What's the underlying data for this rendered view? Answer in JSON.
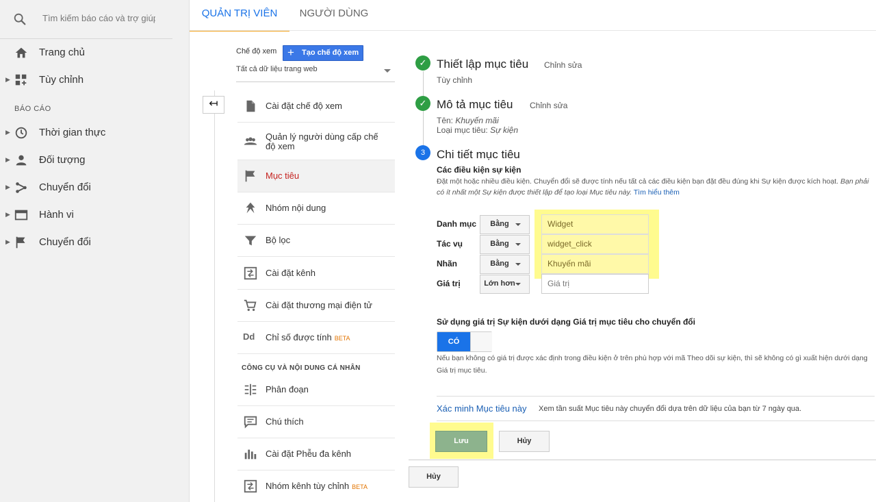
{
  "search": {
    "placeholder": "Tìm kiếm báo cáo và trợ giúp"
  },
  "sidebar": {
    "home": "Trang chủ",
    "customize": "Tùy chỉnh",
    "reports_heading": "BÁO CÁO",
    "reports": [
      "Thời gian thực",
      "Đối tượng",
      "Chuyển đổi",
      "Hành vi",
      "Chuyển đổi"
    ]
  },
  "tabs": {
    "admin": "QUẢN TRỊ VIÊN",
    "user": "NGƯỜI DÙNG"
  },
  "view": {
    "label": "Chế độ xem",
    "create_button": "Tạo chế độ xem",
    "selected": "Tất cả dữ liệu trang web"
  },
  "menu": {
    "items": [
      {
        "label": "Cài đặt chế độ xem",
        "icon": "document-icon"
      },
      {
        "label": "Quản lý người dùng cấp chế độ xem",
        "icon": "users-icon"
      },
      {
        "label": "Mục tiêu",
        "icon": "flag-icon"
      },
      {
        "label": "Nhóm nội dung",
        "icon": "content-grouping-icon"
      },
      {
        "label": "Bộ lọc",
        "icon": "filter-icon"
      },
      {
        "label": "Cài đặt kênh",
        "icon": "channel-icon"
      },
      {
        "label": "Cài đặt thương mại điện tử",
        "icon": "cart-icon"
      },
      {
        "label": "Chỉ số được tính",
        "icon": "dd-icon",
        "badge": "BETA"
      }
    ],
    "tools_heading": "CÔNG CỤ VÀ NỘI DUNG CÁ NHÂN",
    "tools": [
      {
        "label": "Phân đoạn",
        "icon": "segments-icon"
      },
      {
        "label": "Chú thích",
        "icon": "annotation-icon"
      },
      {
        "label": "Cài đặt Phễu đa kênh",
        "icon": "funnel-chart-icon"
      },
      {
        "label": "Nhóm kênh tùy chỉnh",
        "icon": "channel-group-icon",
        "badge": "BETA"
      }
    ]
  },
  "goal": {
    "step1": {
      "title": "Thiết lập mục tiêu",
      "edit": "Chỉnh sửa",
      "sub": "Tùy chỉnh"
    },
    "step2": {
      "title": "Mô tả mục tiêu",
      "edit": "Chỉnh sửa",
      "name_label": "Tên:",
      "name_value": "Khuyến mãi",
      "type_label": "Loại mục tiêu:",
      "type_value": "Sự kiện"
    },
    "step3": {
      "number": "3",
      "title": "Chi tiết mục tiêu",
      "conditions_title": "Các điều kiện sự kiện",
      "desc_normal": "Đặt một hoặc nhiều điều kiện. Chuyển đổi sẽ được tính nếu tất cả các điều kiện bạn đặt đều đúng khi Sự kiện được kích hoạt.",
      "desc_italic": "Bạn phải có ít nhất một Sự kiện được thiết lập để tạo loại Mục tiêu này.",
      "learn_more": "Tìm hiểu thêm",
      "conditions": [
        {
          "label": "Danh mục",
          "operator": "Bằng",
          "value": "Widget"
        },
        {
          "label": "Tác vụ",
          "operator": "Bằng",
          "value": "widget_click"
        },
        {
          "label": "Nhãn",
          "operator": "Bằng",
          "value": "Khuyến mãi"
        },
        {
          "label": "Giá trị",
          "operator": "Lớn hơn",
          "placeholder": "Giá trị"
        }
      ],
      "use_value_title": "Sử dụng giá trị Sự kiện dưới dạng Giá trị mục tiêu cho chuyển đổi",
      "toggle_on": "CÓ",
      "note": "Nếu bạn không có giá trị được xác định trong điều kiện ở trên phù hợp với mã Theo dõi sự kiện, thì sẽ không có gì xuất hiện dưới dạng Giá trị mục tiêu."
    },
    "verify_link": "Xác minh Mục tiêu này",
    "verify_desc": "Xem tần suất Mục tiêu này chuyển đổi dựa trên dữ liệu của bạn từ 7 ngày qua.",
    "save": "Lưu",
    "cancel": "Hủy",
    "cancel_outer": "Hủy"
  }
}
